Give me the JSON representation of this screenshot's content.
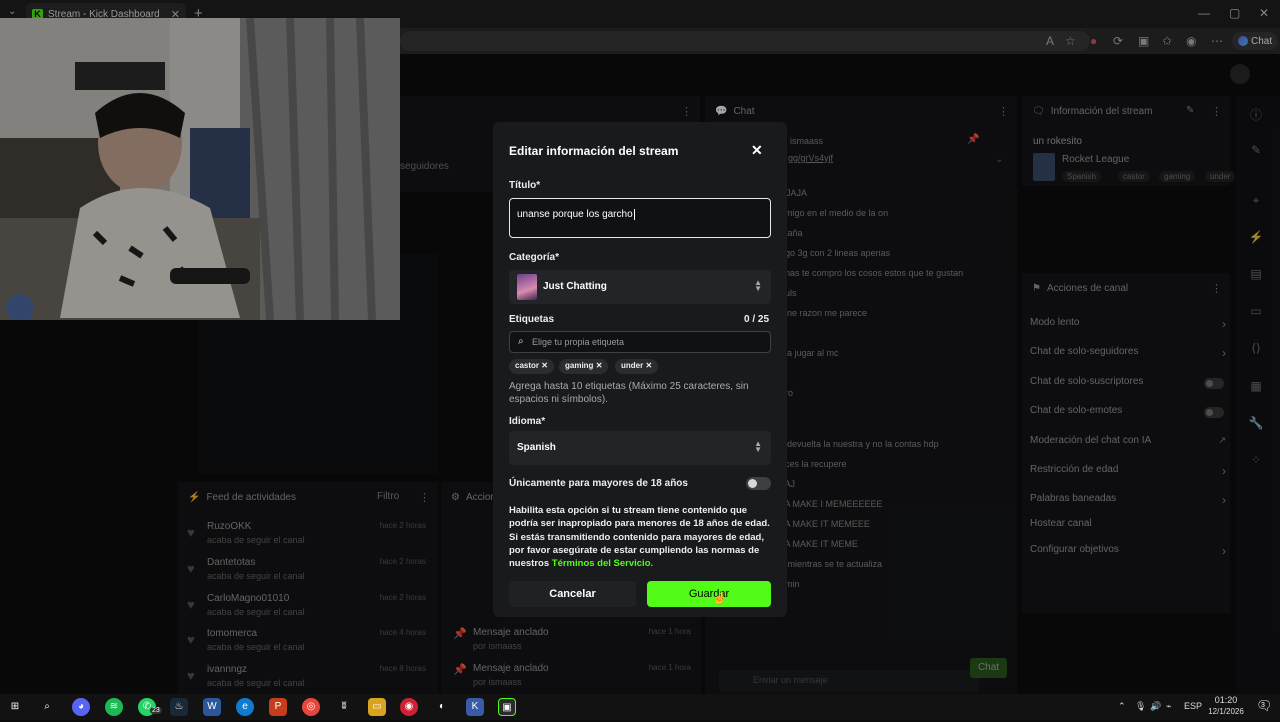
{
  "browser": {
    "tab_title": "Stream - Kick Dashboard",
    "tab_close": "✕",
    "new_tab": "+",
    "chat_button": "Chat"
  },
  "dashboard": {
    "chat_header": "Chat",
    "chat_user": "ismaass",
    "chat_link": "gg/grVs4yjf",
    "chat_lines": [
      "AJAJA",
      "amigo en el medio de la on",
      "ntaña",
      "ngo 3g con 2 lineas apenas",
      "anas te compro los cosos estos que te gustan",
      "nuls",
      "iene razon me parece",
      "y a jugar al mc",
      "ero",
      "s devuelta la nuestra y no la contas hdp",
      "eces la recupere",
      "JAJ",
      "JA MAKE I MEMEEEEEE",
      "JA MAKE IT MEMEEE",
      "JA MAKE IT MEME",
      "o mientras se te actualiza",
      "emin"
    ],
    "chat_placeholder": "Enviar un mensaje",
    "chat_send": "Chat",
    "stream_info_header": "Información del stream",
    "stream_title": "un rokesito",
    "stream_category": "Rocket League",
    "stream_tags": [
      "Spanish",
      "castor",
      "gaming",
      "under"
    ],
    "channel_actions_header": "Acciones de canal",
    "channel_actions": [
      {
        "label": "Modo lento",
        "kind": "chevron"
      },
      {
        "label": "Chat de solo-seguidores",
        "kind": "chevron"
      },
      {
        "label": "Chat de solo-suscriptores",
        "kind": "toggle"
      },
      {
        "label": "Chat de solo-emotes",
        "kind": "toggle"
      },
      {
        "label": "Moderación del chat con IA",
        "kind": "external"
      },
      {
        "label": "Restricción de edad",
        "kind": "chevron"
      },
      {
        "label": "Palabras baneadas",
        "kind": "chevron"
      },
      {
        "label": "Hostear canal",
        "kind": "none"
      },
      {
        "label": "Configurar objetivos",
        "kind": "chevron"
      }
    ],
    "feed_header": "Feed de actividades",
    "feed_filter": "Filtro",
    "feed_items": [
      {
        "name": "RuzoOKK",
        "sub": "acaba de seguir el canal",
        "time": "hace 2 horas"
      },
      {
        "name": "Dantetotas",
        "sub": "acaba de seguir el canal",
        "time": "hace 2 horas"
      },
      {
        "name": "CarloMagno01010",
        "sub": "acaba de seguir el canal",
        "time": "hace 2 horas"
      },
      {
        "name": "tomomerca",
        "sub": "acaba de seguir el canal",
        "time": "hace 4 horas"
      },
      {
        "name": "ivannngz",
        "sub": "acaba de seguir el canal",
        "time": "hace 8 horas"
      }
    ],
    "actions_header": "Accion",
    "pinned_items": [
      {
        "name": "Mensaje anclado",
        "by": "por ismaass",
        "time": "hace 1 hora"
      },
      {
        "name": "Mensaje anclado",
        "by": "por ismaass",
        "time": "hace 1 hora"
      }
    ],
    "left_stub_followers": "seguidores"
  },
  "modal": {
    "title": "Editar información del stream",
    "title_label": "Título*",
    "title_value": "unanse porque los garcho",
    "category_label": "Categoría*",
    "category_value": "Just Chatting",
    "tags_label": "Etiquetas",
    "tags_count": "0 / 25",
    "tags_placeholder": "Elige tu propia etiqueta",
    "tags": [
      "castor",
      "gaming",
      "under"
    ],
    "tags_hint": "Agrega hasta 10 etiquetas (Máximo 25 caracteres, sin espacios ni símbolos).",
    "language_label": "Idioma*",
    "language_value": "Spanish",
    "mature_label": "Únicamente para mayores de 18 años",
    "mature_desc": "Habilita esta opción si tu stream tiene contenido que podría ser inapropiado para menores de 18 años de edad. Si estás transmitiendo contenido para mayores de edad, por favor asegúrate de estar cumpliendo las normas de nuestros",
    "mature_link": "Términos del Servicio.",
    "cancel": "Cancelar",
    "save": "Guardar"
  },
  "taskbar": {
    "time": "01:20",
    "date": "12/1/2026",
    "lang": "ESP",
    "whatsapp_badge": "23",
    "notif_count": "3"
  },
  "colors": {
    "accent": "#53fc18",
    "modal_bg": "#181a1c",
    "page_bg": "#0d0d0e"
  }
}
